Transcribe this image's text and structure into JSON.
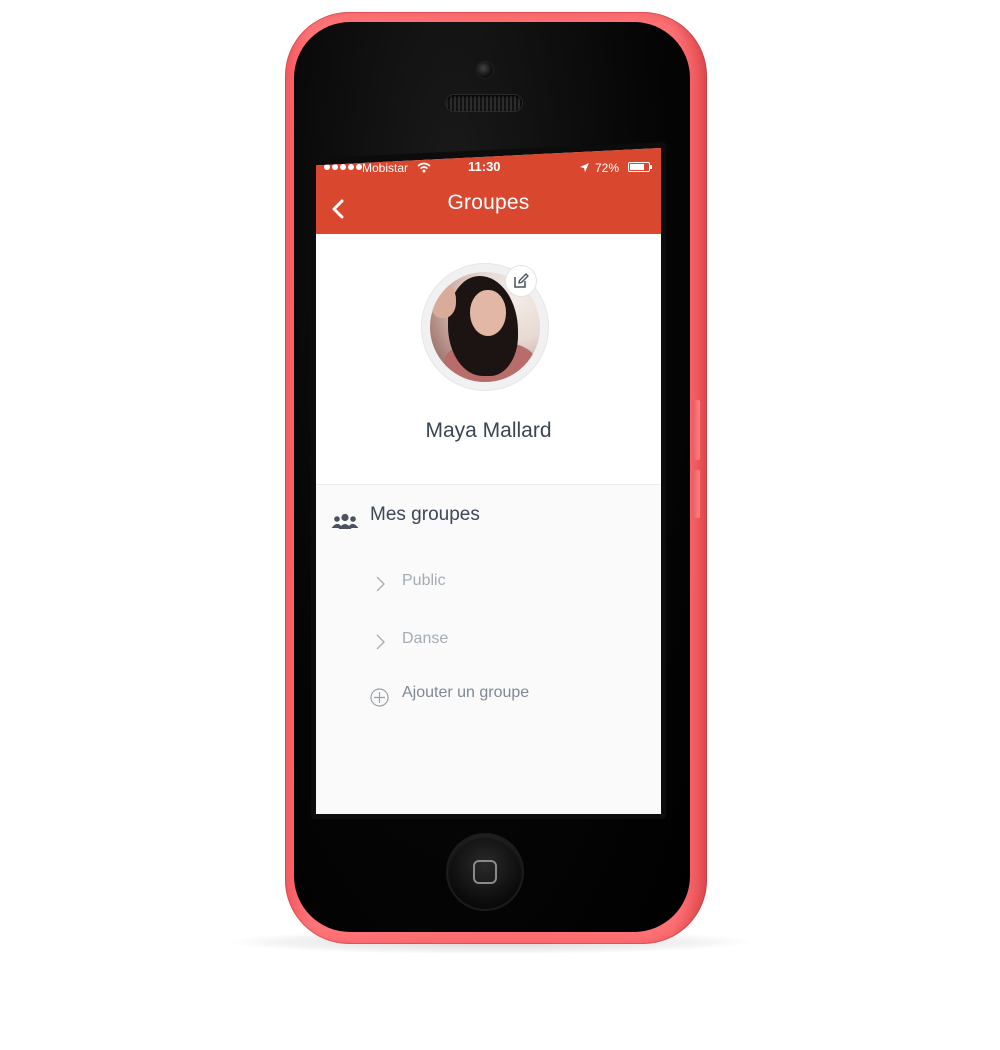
{
  "status_bar": {
    "carrier": "Mobistar",
    "time": "11:30",
    "battery": "72%"
  },
  "nav": {
    "title": "Groupes"
  },
  "profile": {
    "name": "Maya Mallard"
  },
  "groups": {
    "section_title": "Mes groupes",
    "items": [
      {
        "label": "Public"
      },
      {
        "label": "Danse"
      }
    ],
    "add_label": "Ajouter un groupe"
  },
  "colors": {
    "header": "#d9472f",
    "phone_case": "#ff6f72",
    "name_text": "#3b4653",
    "muted_text": "#a4abb3"
  },
  "icons": {
    "back": "chevron-left-icon",
    "edit": "edit-icon",
    "groups": "people-icon",
    "item": "chevron-right-icon",
    "add": "plus-circle-icon"
  }
}
